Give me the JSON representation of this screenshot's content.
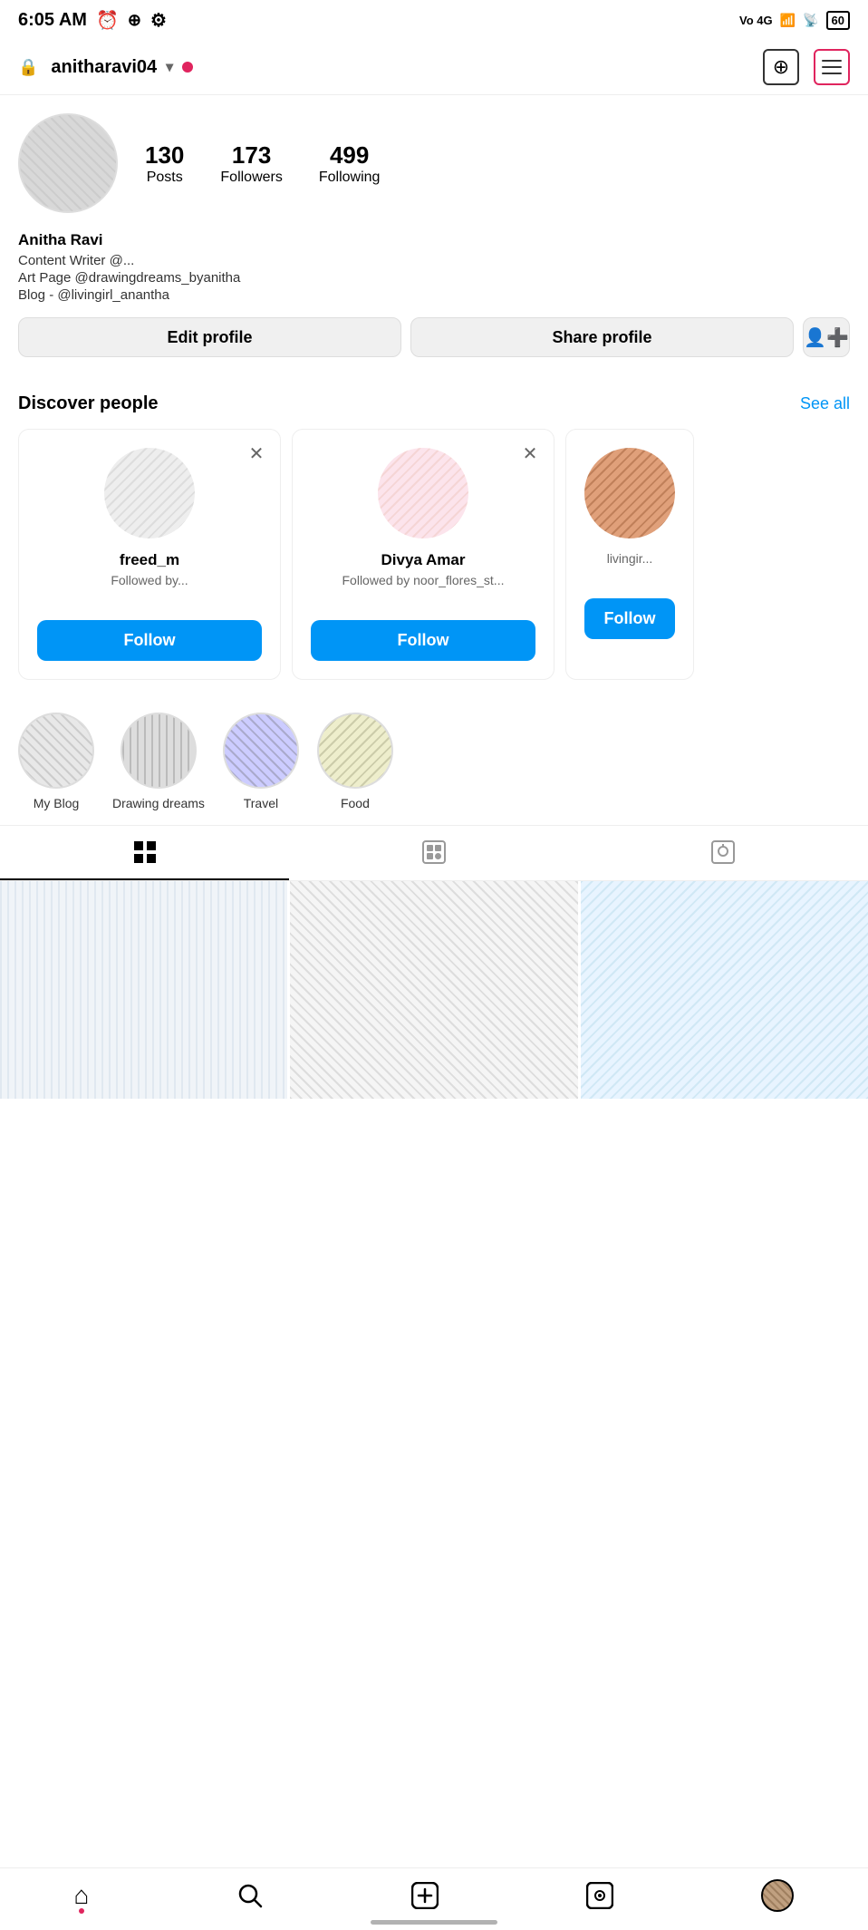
{
  "statusBar": {
    "time": "6:05 AM",
    "battery": "60"
  },
  "topNav": {
    "username": "anitharavi04",
    "addIcon": "➕",
    "menuIcon": "☰"
  },
  "profile": {
    "stats": {
      "posts": "130",
      "postsLabel": "Posts",
      "followers": "173",
      "followersLabel": "Followers",
      "following": "499",
      "followingLabel": "Following"
    },
    "name": "Anitha Ravi",
    "bioLine1": "Content Writer @...",
    "bioLine2": "Art Page @drawingdreams_byanitha",
    "bioLine3": "Blog - @livingirl_anantha"
  },
  "actionButtons": {
    "editProfile": "Edit profile",
    "shareProfile": "Share profile"
  },
  "discover": {
    "title": "Discover people",
    "seeAll": "See all",
    "cards": [
      {
        "name": "freed_m",
        "sub": "Followed by...",
        "followLabel": "Follow"
      },
      {
        "name": "Divya Amar",
        "sub": "Followed by noor_flores_st...",
        "followLabel": "Follow"
      },
      {
        "name": "",
        "sub": "livingir...",
        "followLabel": "Follow"
      }
    ]
  },
  "highlights": [
    {
      "label": "My Blog"
    },
    {
      "label": "Drawing dreams"
    },
    {
      "label": "Travel"
    },
    {
      "label": "Food"
    }
  ],
  "tabs": [
    {
      "label": "grid",
      "icon": "⊞",
      "active": true
    },
    {
      "label": "reels",
      "icon": "▷",
      "active": false
    },
    {
      "label": "tagged",
      "icon": "◻",
      "active": false
    }
  ],
  "bottomNav": {
    "items": [
      {
        "name": "home",
        "icon": "⌂"
      },
      {
        "name": "search",
        "icon": "🔍"
      },
      {
        "name": "add",
        "icon": "⊕"
      },
      {
        "name": "reels",
        "icon": "▣"
      },
      {
        "name": "profile",
        "icon": "avatar"
      }
    ]
  }
}
